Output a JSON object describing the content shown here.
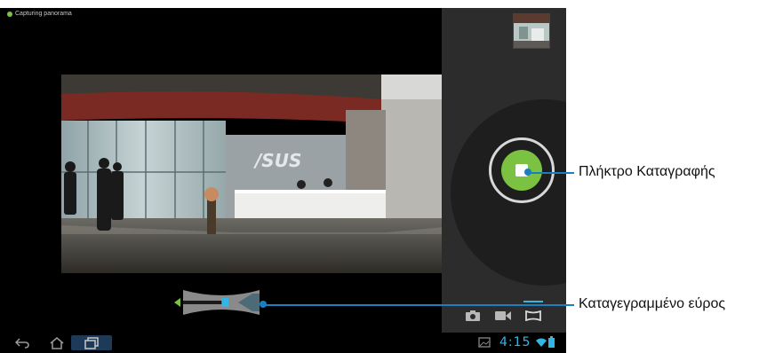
{
  "status_bar": {
    "text": "Capturing panorama"
  },
  "navigation": {
    "back": "back-icon",
    "home": "home-icon",
    "recents": "recent-apps-icon"
  },
  "system_tray": {
    "time": "4:15"
  },
  "camera": {
    "shutter_state": "recording",
    "mode_selected": "panorama",
    "modes": [
      "camera-icon",
      "video-icon",
      "panorama-icon"
    ],
    "capture_progress": 0.55
  },
  "callouts": {
    "record_button": "Πλήκτρο Καταγραφής",
    "captured_range": "Καταγεγραμμένο εύρος"
  },
  "colors": {
    "accent_blue": "#33b5e5",
    "record_green": "#7cc242",
    "callout_blue": "#1a7fc1"
  }
}
